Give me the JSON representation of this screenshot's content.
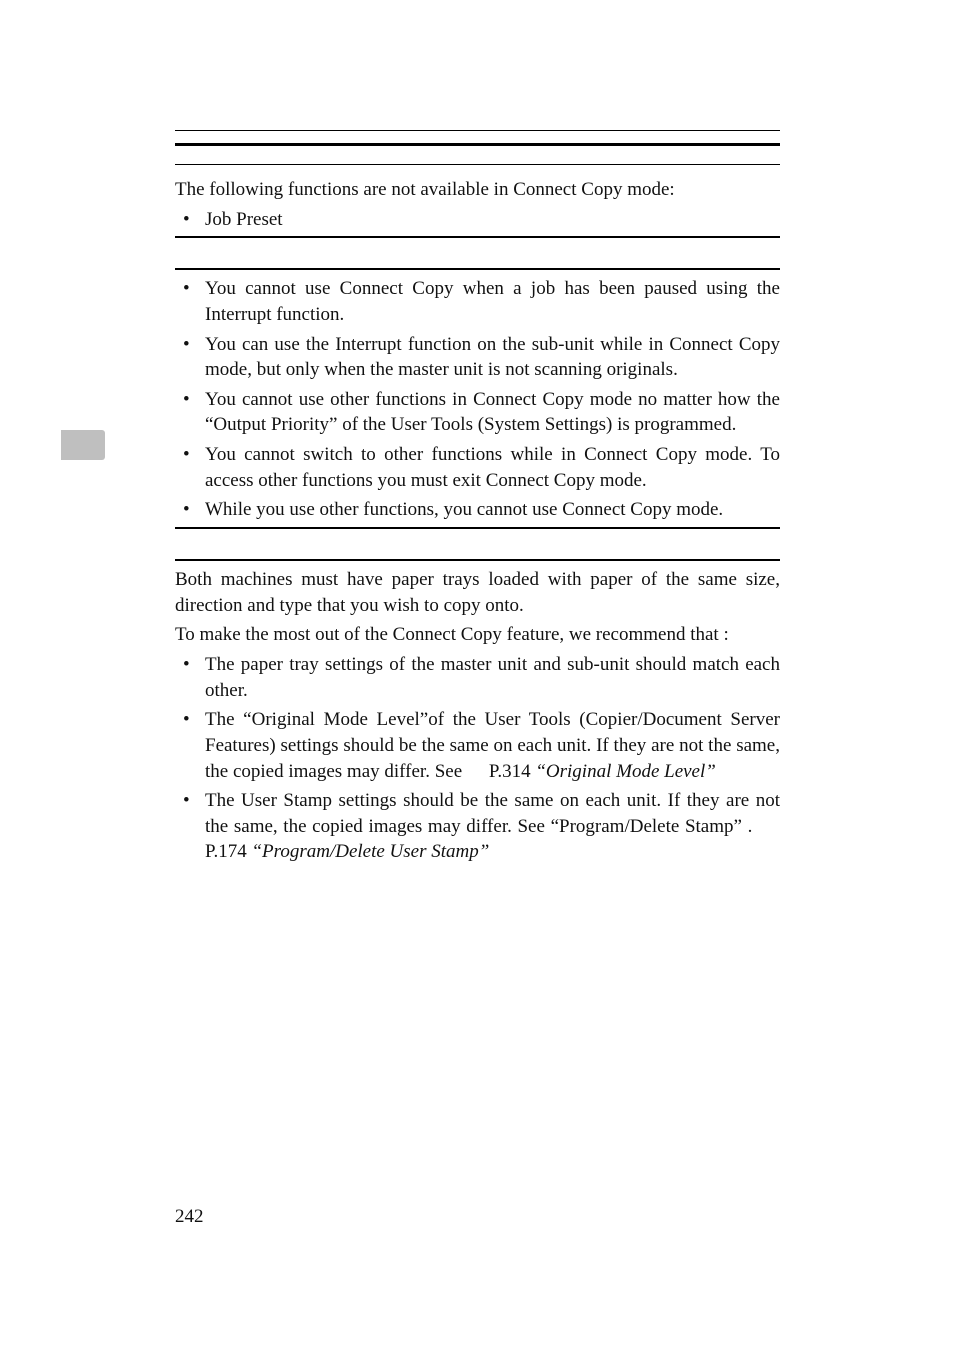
{
  "section1": {
    "intro": "The following functions are not available in Connect Copy mode:",
    "items": [
      "Job Preset"
    ]
  },
  "section2": {
    "items": [
      "You cannot use Connect Copy when a job has been paused using the Interrupt function.",
      "You can use the Interrupt function on the sub-unit while in Connect Copy mode, but only when the master unit is not scanning originals.",
      "You cannot use other functions in Connect Copy mode no matter how the “Output Priority” of the User Tools (System Settings) is programmed.",
      "You cannot switch to other functions while in Connect Copy mode. To access other functions you must exit Connect Copy mode.",
      "While you use other functions, you cannot use Connect Copy mode."
    ]
  },
  "section3": {
    "para1": "Both machines must have paper trays loaded with paper of the same size, direction and type that you wish to copy onto.",
    "para2": "To make the most out of the Connect Copy feature, we recommend that :",
    "item1": "The paper tray settings of the master unit and sub-unit should match each other.",
    "item2_a": "The “Original Mode Level”of the User Tools (Copier/Document Server Features) settings should be the same on each unit. If they are not the same, the copied images may differ. See ",
    "item2_ref_page": "P.314 ",
    "item2_ref_title": "“Original Mode Level”",
    "item3_a": "The User Stamp settings should be the same on each unit. If they are not the same, the copied images may differ. See “Program/Delete Stamp” . ",
    "item3_ref_page": "P.174 ",
    "item3_ref_title": "“Program/Delete User Stamp”"
  },
  "page_number": "242"
}
